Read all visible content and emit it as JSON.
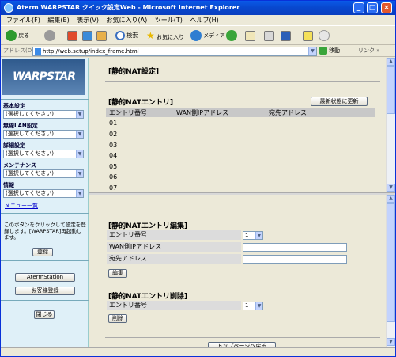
{
  "window": {
    "title": "Aterm WARPSTAR クイック設定Web - Microsoft Internet Explorer",
    "min": "_",
    "max": "□",
    "close": "×"
  },
  "menubar": [
    "ファイル(F)",
    "編集(E)",
    "表示(V)",
    "お気に入り(A)",
    "ツール(T)",
    "ヘルプ(H)"
  ],
  "toolbar": {
    "back": "戻る",
    "search": "検索",
    "favorites": "お気に入り",
    "media": "メディア"
  },
  "address": {
    "label": "アドレス(D)",
    "url": "http://web.setup/index_frame.html",
    "go": "移動",
    "links": "リンク »"
  },
  "sidebar": {
    "logo": "WARPSTAR",
    "groups": [
      {
        "label": "基本設定",
        "value": "(選択してください)"
      },
      {
        "label": "無線LAN設定",
        "value": "(選択してください)"
      },
      {
        "label": "詳細設定",
        "value": "(選択してください)"
      },
      {
        "label": "メンテナンス",
        "value": "(選択してください)"
      },
      {
        "label": "情報",
        "value": "(選択してください)"
      }
    ],
    "menu_list": "メニュー一覧",
    "note": "このボタンをクリックして設定を登録します。[WARPSTAR]再起動します。",
    "register": "登録",
    "aterm_station": "AtermStation",
    "customer_register": "お客様登録",
    "close": "閉じる"
  },
  "top": {
    "page_title": "[静的NAT設定]",
    "section": "[静的NATエントリ]",
    "refresh": "最新状態に更新",
    "columns": [
      "エントリ番号",
      "WAN側IPアドレス",
      "宛先アドレス"
    ],
    "rows": [
      "01",
      "02",
      "03",
      "04",
      "05",
      "06",
      "07"
    ]
  },
  "bottom": {
    "edit_title": "[静的NATエントリ編集]",
    "edit_fields": [
      {
        "label": "エントリ番号",
        "value": "1"
      },
      {
        "label": "WAN側IPアドレス",
        "value": ""
      },
      {
        "label": "宛先アドレス",
        "value": ""
      }
    ],
    "edit_button": "編集",
    "delete_title": "[静的NATエントリ削除]",
    "delete_field": {
      "label": "エントリ番号",
      "value": "1"
    },
    "delete_button": "削除",
    "back_top": "トップページへ戻る"
  }
}
